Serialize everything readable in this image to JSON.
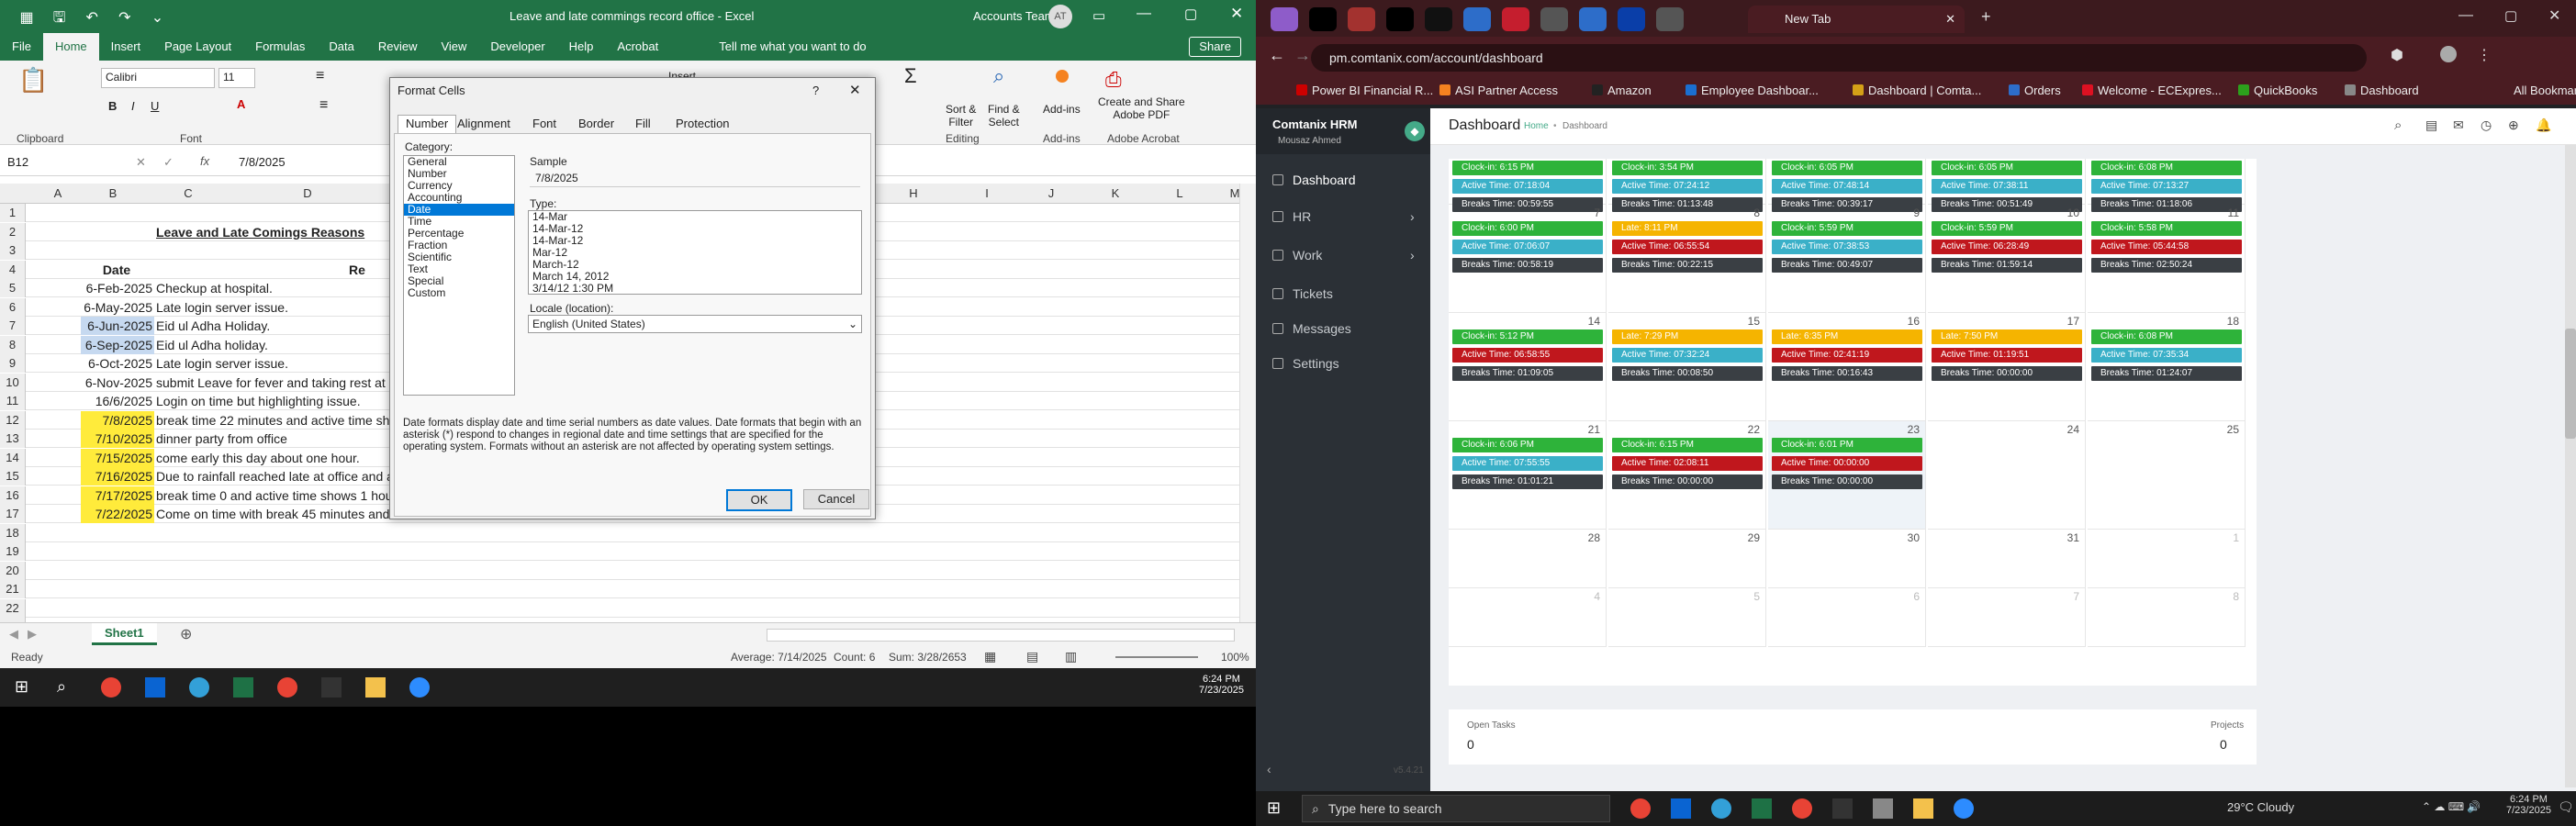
{
  "excel": {
    "title": "Leave and late commings record office  -  Excel",
    "account": "Accounts Team",
    "avatar": "AT",
    "share": "Share",
    "tabs": [
      "File",
      "Home",
      "Insert",
      "Page Layout",
      "Formulas",
      "Data",
      "Review",
      "View",
      "Developer",
      "Help",
      "Acrobat"
    ],
    "tell": "Tell me what you want to do",
    "clipboard": "Clipboard",
    "font_group": "Font",
    "editing": "Editing",
    "addins": "Add-ins",
    "adobe": "Adobe Acrobat",
    "font_name": "Calibri",
    "font_size": "11",
    "sort": "Sort &\nFilter",
    "find": "Find &\nSelect",
    "addins_btn": "Add-ins",
    "adobe_btn": "Create and Share\nAdobe PDF",
    "insert_btn": "Insert",
    "name_box": "B12",
    "formula": "7/8/2025",
    "cols": [
      "A",
      "B",
      "C",
      "D",
      "E",
      "F",
      "G",
      "H",
      "I",
      "J",
      "K",
      "L",
      "M"
    ],
    "row_numbers": [
      "1",
      "2",
      "3",
      "4",
      "5",
      "6",
      "7",
      "8",
      "9",
      "10",
      "11",
      "12",
      "13",
      "14",
      "15",
      "16",
      "17",
      "18",
      "19",
      "20",
      "21",
      "22",
      "23"
    ],
    "heading": "Leave and Late Comings Reasons",
    "col_date": "Date",
    "col_reason": "Re",
    "rows": [
      {
        "date": "6-Feb-2025",
        "reason": "Checkup at hospital."
      },
      {
        "date": "6-May-2025",
        "reason": "Late login server issue."
      },
      {
        "date": "6-Jun-2025",
        "reason": "Eid ul Adha Holiday."
      },
      {
        "date": "6-Sep-2025",
        "reason": "Eid ul Adha holiday."
      },
      {
        "date": "6-Oct-2025",
        "reason": "Late login server issue."
      },
      {
        "date": "6-Nov-2025",
        "reason": "submit Leave for fever and taking rest at"
      },
      {
        "date": "16/6/2025",
        "reason": "Login on time but highlighting issue."
      },
      {
        "date": "7/8/2025",
        "reason": "break time 22 minutes and active time sho"
      },
      {
        "date": "7/10/2025",
        "reason": "dinner party from office"
      },
      {
        "date": "7/15/2025",
        "reason": "come early this day about one hour."
      },
      {
        "date": "7/16/2025",
        "reason": "Due to rainfall reached late at office and a"
      },
      {
        "date": "7/17/2025",
        "reason": "break time 0 and active time shows 1 hou"
      },
      {
        "date": "7/22/2025",
        "reason": "Come on time with break 45 minutes and"
      }
    ],
    "sheet_tab": "Sheet1",
    "status_ready": "Ready",
    "status_avg": "Average: 7/14/2025",
    "status_count": "Count: 6",
    "status_sum": "Sum: 3/28/2653",
    "zoom": "100%"
  },
  "dialog": {
    "title": "Format Cells",
    "help": "?",
    "tabs": [
      "Number",
      "Alignment",
      "Font",
      "Border",
      "Fill",
      "Protection"
    ],
    "category_label": "Category:",
    "categories": [
      "General",
      "Number",
      "Currency",
      "Accounting",
      "Date",
      "Time",
      "Percentage",
      "Fraction",
      "Scientific",
      "Text",
      "Special",
      "Custom"
    ],
    "selected_category": "Date",
    "sample_label": "Sample",
    "sample": "7/8/2025",
    "type_label": "Type:",
    "types": [
      "14-Mar",
      "14-Mar-12",
      "14-Mar-12",
      "Mar-12",
      "March-12",
      "March 14, 2012",
      "3/14/12 1:30 PM"
    ],
    "locale_label": "Locale (location):",
    "locale": "English (United States)",
    "description": "Date formats display date and time serial numbers as date values.  Date formats that begin with an asterisk (*) respond to changes in regional date and time settings that are specified for the operating system. Formats without an asterisk are not affected by operating system settings.",
    "ok": "OK",
    "cancel": "Cancel"
  },
  "taskbar_left": {
    "time": "6:24 PM",
    "date": "7/23/2025"
  },
  "chrome": {
    "tab_title": "New Tab",
    "url": "pm.comtanix.com/account/dashboard",
    "bookmarks": [
      "Power BI Financial R...",
      "ASI Partner Access",
      "Amazon",
      "Employee Dashboar...",
      "Dashboard | Comta...",
      "Orders",
      "Welcome - ECExpres...",
      "QuickBooks",
      "Dashboard"
    ],
    "all_bookmarks": "All Bookmarks",
    "brand": "Comtanix HRM",
    "user": "Mousaz Ahmed",
    "nav": [
      "Dashboard",
      "HR",
      "Work",
      "Tickets",
      "Messages",
      "Settings"
    ],
    "version": "v5.4.21",
    "page_title": "Dashboard",
    "crumb_home": "Home",
    "crumb_sep": "•",
    "crumb_page": "Dashboard",
    "weeks": [
      {
        "days": [
          {
            "num": "",
            "items": [
              [
                "g",
                "Clock-in: 6:15 PM"
              ],
              [
                "t",
                "Active Time: 07:18:04"
              ],
              [
                "d",
                "Breaks Time: 00:59:55"
              ]
            ]
          },
          {
            "num": "",
            "items": [
              [
                "g",
                "Clock-in: 3:54 PM"
              ],
              [
                "t",
                "Active Time: 07:24:12"
              ],
              [
                "d",
                "Breaks Time: 01:13:48"
              ]
            ]
          },
          {
            "num": "",
            "items": [
              [
                "g",
                "Clock-in: 6:05 PM"
              ],
              [
                "t",
                "Active Time: 07:48:14"
              ],
              [
                "d",
                "Breaks Time: 00:39:17"
              ]
            ]
          },
          {
            "num": "",
            "items": [
              [
                "g",
                "Clock-in: 6:05 PM"
              ],
              [
                "t",
                "Active Time: 07:38:11"
              ],
              [
                "d",
                "Breaks Time: 00:51:49"
              ]
            ]
          },
          {
            "num": "",
            "items": [
              [
                "g",
                "Clock-in: 6:08 PM"
              ],
              [
                "t",
                "Active Time: 07:13:27"
              ],
              [
                "d",
                "Breaks Time: 01:18:06"
              ]
            ]
          }
        ]
      },
      {
        "days": [
          {
            "num": "7",
            "items": [
              [
                "g",
                "Clock-in: 6:00 PM"
              ],
              [
                "t",
                "Active Time: 07:06:07"
              ],
              [
                "d",
                "Breaks Time: 00:58:19"
              ]
            ]
          },
          {
            "num": "8",
            "items": [
              [
                "o",
                "Late: 8:11 PM"
              ],
              [
                "r",
                "Active Time: 06:55:54"
              ],
              [
                "d",
                "Breaks Time: 00:22:15"
              ]
            ]
          },
          {
            "num": "9",
            "items": [
              [
                "g",
                "Clock-in: 5:59 PM"
              ],
              [
                "t",
                "Active Time: 07:38:53"
              ],
              [
                "d",
                "Breaks Time: 00:49:07"
              ]
            ]
          },
          {
            "num": "10",
            "items": [
              [
                "g",
                "Clock-in: 5:59 PM"
              ],
              [
                "r",
                "Active Time: 06:28:49"
              ],
              [
                "d",
                "Breaks Time: 01:59:14"
              ]
            ]
          },
          {
            "num": "11",
            "items": [
              [
                "g",
                "Clock-in: 5:58 PM"
              ],
              [
                "r",
                "Active Time: 05:44:58"
              ],
              [
                "d",
                "Breaks Time: 02:50:24"
              ]
            ]
          }
        ]
      },
      {
        "days": [
          {
            "num": "14",
            "items": [
              [
                "g",
                "Clock-in: 5:12 PM"
              ],
              [
                "r",
                "Active Time: 06:58:55"
              ],
              [
                "d",
                "Breaks Time: 01:09:05"
              ]
            ]
          },
          {
            "num": "15",
            "items": [
              [
                "o",
                "Late: 7:29 PM"
              ],
              [
                "t",
                "Active Time: 07:32:24"
              ],
              [
                "d",
                "Breaks Time: 00:08:50"
              ]
            ]
          },
          {
            "num": "16",
            "items": [
              [
                "o",
                "Late: 6:35 PM"
              ],
              [
                "r",
                "Active Time: 02:41:19"
              ],
              [
                "d",
                "Breaks Time: 00:16:43"
              ]
            ]
          },
          {
            "num": "17",
            "items": [
              [
                "o",
                "Late: 7:50 PM"
              ],
              [
                "r",
                "Active Time: 01:19:51"
              ],
              [
                "d",
                "Breaks Time: 00:00:00"
              ]
            ]
          },
          {
            "num": "18",
            "items": [
              [
                "g",
                "Clock-in: 6:08 PM"
              ],
              [
                "t",
                "Active Time: 07:35:34"
              ],
              [
                "d",
                "Breaks Time: 01:24:07"
              ]
            ]
          }
        ]
      },
      {
        "days": [
          {
            "num": "21",
            "items": [
              [
                "g",
                "Clock-in: 6:06 PM"
              ],
              [
                "t",
                "Active Time: 07:55:55"
              ],
              [
                "d",
                "Breaks Time: 01:01:21"
              ]
            ]
          },
          {
            "num": "22",
            "items": [
              [
                "g",
                "Clock-in: 6:15 PM"
              ],
              [
                "r",
                "Active Time: 02:08:11"
              ],
              [
                "d",
                "Breaks Time: 00:00:00"
              ]
            ]
          },
          {
            "num": "23",
            "items": [
              [
                "g",
                "Clock-in: 6:01 PM"
              ],
              [
                "r",
                "Active Time: 00:00:00"
              ],
              [
                "d",
                "Breaks Time: 00:00:00"
              ]
            ]
          },
          {
            "num": "24",
            "items": []
          },
          {
            "num": "25",
            "items": []
          }
        ]
      },
      {
        "days": [
          {
            "num": "28",
            "items": []
          },
          {
            "num": "29",
            "items": []
          },
          {
            "num": "30",
            "items": []
          },
          {
            "num": "31",
            "items": []
          },
          {
            "num": "1",
            "items": []
          }
        ]
      },
      {
        "days": [
          {
            "num": "4",
            "items": []
          },
          {
            "num": "5",
            "items": []
          },
          {
            "num": "6",
            "items": []
          },
          {
            "num": "7",
            "items": []
          },
          {
            "num": "8",
            "items": []
          }
        ]
      }
    ],
    "open_tasks_label": "Open Tasks",
    "open_tasks": "0",
    "projects_label": "Projects",
    "projects": "0"
  },
  "taskbar_right": {
    "search": "Type here to search",
    "weather": "29°C  Cloudy",
    "time": "6:24 PM",
    "date": "7/23/2025"
  }
}
